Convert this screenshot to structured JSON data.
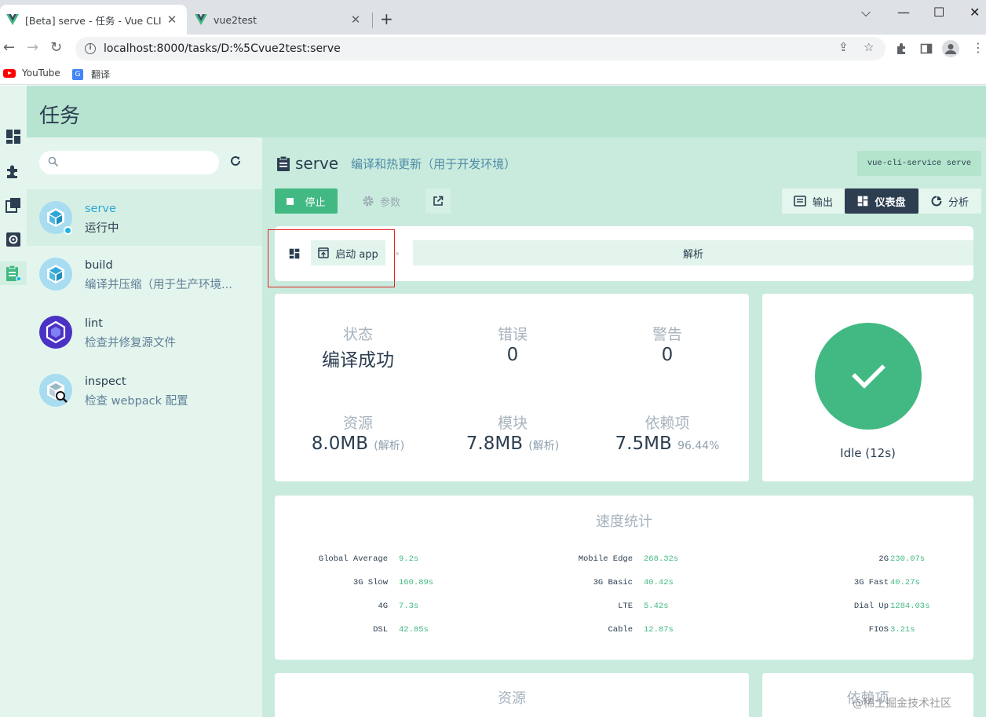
{
  "browser": {
    "tabs": [
      {
        "title": "[Beta] serve - 任务 - Vue CLI",
        "close": "✕"
      },
      {
        "title": "vue2test",
        "close": "✕"
      }
    ],
    "new_tab": "+",
    "window_controls": {
      "dropdown": "⌵",
      "minimize": "—",
      "maximize": "☐",
      "close": "✕"
    },
    "url": "localhost:8000/tasks/D:%5Cvue2test:serve",
    "bookmarks": [
      {
        "label": "YouTube",
        "icon": "youtube-icon"
      },
      {
        "label": "翻译",
        "icon": "translate-icon"
      }
    ]
  },
  "app": {
    "title": "任务",
    "left_nav": [
      "dashboard-icon",
      "plugins-icon",
      "dependencies-icon",
      "configuration-icon",
      "tasks-icon"
    ],
    "search": {
      "placeholder": ""
    },
    "tasks": [
      {
        "name": "serve",
        "description": "运行中",
        "status": "running"
      },
      {
        "name": "build",
        "description": "编译并压缩（用于生产环境..."
      },
      {
        "name": "lint",
        "description": "检查并修复源文件"
      },
      {
        "name": "inspect",
        "description": "检查 webpack 配置"
      }
    ],
    "current_task": {
      "name": "serve",
      "description": "编译和热更新（用于开发环境）",
      "command": "vue-cli-service serve"
    },
    "actions": {
      "stop": "停止",
      "params": "参数"
    },
    "views": {
      "output": "输出",
      "dashboard": "仪表盘",
      "analyzer": "分析"
    },
    "widgets": {
      "launch": "启动 app",
      "analyze": "解析"
    },
    "status": {
      "status_label": "状态",
      "status_value": "编译成功",
      "errors_label": "错误",
      "errors_value": "0",
      "warnings_label": "警告",
      "warnings_value": "0",
      "assets_label": "资源",
      "assets_value": "8.0MB",
      "assets_sub": "(解析)",
      "modules_label": "模块",
      "modules_value": "7.8MB",
      "modules_sub": "(解析)",
      "deps_label": "依赖项",
      "deps_value": "7.5MB",
      "deps_sub": "96.44%"
    },
    "idle": {
      "text": "Idle (12s)"
    },
    "speed": {
      "title": "速度统计",
      "columns": [
        [
          {
            "name": "Global Average",
            "value": "9.2s"
          },
          {
            "name": "3G Slow",
            "value": "160.89s"
          },
          {
            "name": "4G",
            "value": "7.3s"
          },
          {
            "name": "DSL",
            "value": "42.85s"
          }
        ],
        [
          {
            "name": "Mobile Edge",
            "value": "268.32s"
          },
          {
            "name": "3G Basic",
            "value": "40.42s"
          },
          {
            "name": "LTE",
            "value": "5.42s"
          },
          {
            "name": "Cable",
            "value": "12.87s"
          }
        ],
        [
          {
            "name": "2G",
            "value": "230.07s"
          },
          {
            "name": "3G Fast",
            "value": "40.27s"
          },
          {
            "name": "Dial Up",
            "value": "1284.03s"
          },
          {
            "name": "FIOS",
            "value": "3.21s"
          }
        ]
      ]
    },
    "assets_title": "资源",
    "deps_title": "依赖项"
  },
  "watermark": "@稀土掘金技术社区",
  "colors": {
    "accent": "#42b983",
    "dark": "#2c3e50",
    "header": "#b7e4d1",
    "highlight": "#e02424"
  }
}
